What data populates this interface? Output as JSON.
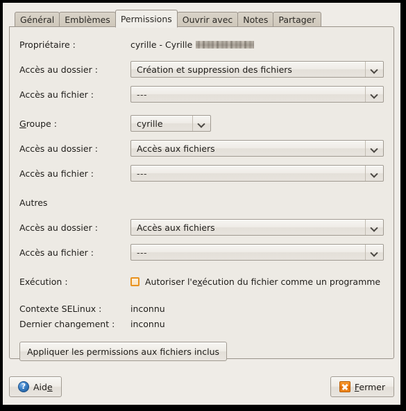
{
  "window": {
    "title": "Permissions",
    "background": "#efece7",
    "panel_background": "#edeae4",
    "frame_color": "#000000",
    "accent_orange": "#e8921f"
  },
  "tabs": [
    {
      "label": "Général",
      "active": false
    },
    {
      "label": "Emblèmes",
      "active": false
    },
    {
      "label": "Permissions",
      "active": true
    },
    {
      "label": "Ouvrir avec",
      "active": false
    },
    {
      "label": "Notes",
      "active": false
    },
    {
      "label": "Partager",
      "active": false
    }
  ],
  "owner": {
    "label": "Propriétaire :",
    "value": "cyrille - Cyrille",
    "redacted": true,
    "folder_access": {
      "label": "Accès au dossier :",
      "value": "Création et suppression des fichiers"
    },
    "file_access": {
      "label": "Accès au fichier :",
      "value": "---"
    }
  },
  "group": {
    "label": "Groupe :",
    "value": "cyrille",
    "folder_access": {
      "label": "Accès au dossier :",
      "value": "Accès aux fichiers"
    },
    "file_access": {
      "label": "Accès au fichier :",
      "value": "---"
    }
  },
  "others": {
    "label": "Autres",
    "folder_access": {
      "label": "Accès au dossier :",
      "value": "Accès aux fichiers"
    },
    "file_access": {
      "label": "Accès au fichier :",
      "value": "---"
    }
  },
  "execution": {
    "label": "Exécution :",
    "checkbox_label": "Autoriser l'exécution du fichier comme un programme",
    "checked": false
  },
  "selinux": {
    "label": "Contexte SELinux :",
    "value": "inconnu"
  },
  "last_change": {
    "label": "Dernier changement :",
    "value": "inconnu"
  },
  "apply_button": {
    "label": "Appliquer les permissions aux fichiers inclus"
  },
  "actions": {
    "help": {
      "label": "Aide",
      "icon": "help-circle-icon"
    },
    "close": {
      "label": "Fermer",
      "icon": "close-x-icon"
    }
  }
}
